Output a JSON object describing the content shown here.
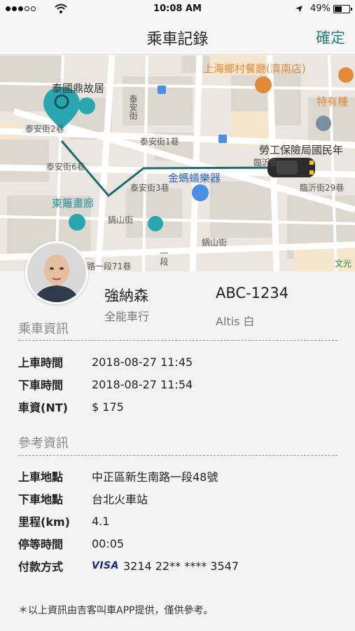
{
  "status_bar": {
    "time": "10:08 AM",
    "battery_pct": "49%",
    "battery_level": 0.49,
    "signal_bars_on": 3,
    "signal_bars_total": 5,
    "icons": [
      "signal-dots-icon",
      "wifi-icon",
      "location-arrow-icon",
      "battery-icon"
    ]
  },
  "nav": {
    "title": "乘車記錄",
    "confirm": "確定"
  },
  "map": {
    "labels": {
      "l1": "泰國鼎故居",
      "l2": "泰安街2巷",
      "l3": "泰安街6巷",
      "l4": "泰安街1巷",
      "l5": "泰安街3巷",
      "l6": "東籬畫廊",
      "l7": "鍋山街",
      "l8": "金螞蟻樂器",
      "l9": "上海鄉村餐廳(濟南店)",
      "l10": "特有種",
      "l11": "勞工保險局國民年",
      "l12": "臨沂街",
      "l13": "臨沂街29巷",
      "l14": "鍋山街",
      "l15": "路一段71巷",
      "l16": "文光",
      "l17": "泰安街",
      "l18": "一段"
    }
  },
  "driver": {
    "name": "強納森",
    "company": "全能車行",
    "plate": "ABC-1234",
    "car": "Altis 白"
  },
  "ride_info": {
    "title": "乘車資訊",
    "rows": [
      {
        "k": "上車時間",
        "v": "2018-08-27 11:45"
      },
      {
        "k": "下車時間",
        "v": "2018-08-27 11:54"
      },
      {
        "k": "車資(NT)",
        "v": "$ 175"
      }
    ]
  },
  "ref_info": {
    "title": "參考資訊",
    "rows": [
      {
        "k": "上車地點",
        "v": "中正區新生南路一段48號"
      },
      {
        "k": "下車地點",
        "v": "台北火車站"
      },
      {
        "k": "里程(km)",
        "v": "4.1"
      },
      {
        "k": "停等時間",
        "v": "00:05"
      },
      {
        "k": "付款方式",
        "v": "3214 22** **** 3547"
      }
    ],
    "card_brand": "VISA"
  },
  "footnote": "＊以上資訊由吉客叫車APP提供，僅供參考。",
  "colors": {
    "accent": "#2a7d7a",
    "route": "#1f6b6e",
    "pin": "#2aa6b0"
  }
}
